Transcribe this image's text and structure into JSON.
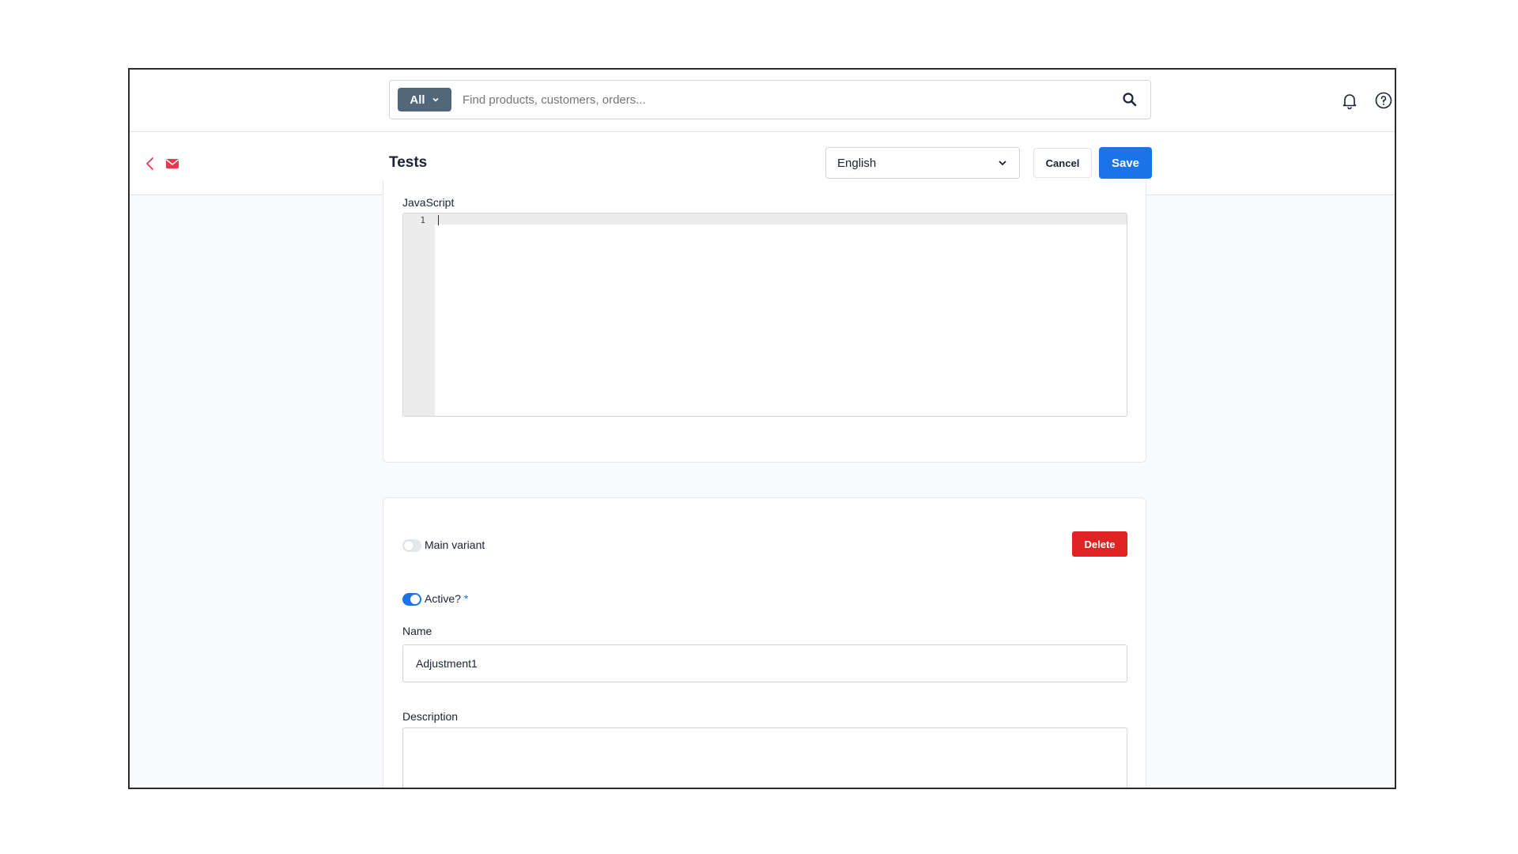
{
  "search": {
    "scope": "All",
    "placeholder": "Find products, customers, orders..."
  },
  "header": {
    "title": "Tests",
    "language": "English",
    "cancel_label": "Cancel",
    "save_label": "Save"
  },
  "javascript_section": {
    "label": "JavaScript",
    "line_number": "1",
    "code": ""
  },
  "variant": {
    "main_variant_label": "Main variant",
    "main_variant_on": false,
    "delete_label": "Delete",
    "active_label": "Active?",
    "active_required_marker": "*",
    "active_on": true,
    "name_label": "Name",
    "name_value": "Adjustment1",
    "description_label": "Description",
    "description_value": ""
  },
  "colors": {
    "primary": "#1a73e8",
    "danger": "#e02424",
    "accent_icon": "#e8394d",
    "scope_button": "#52667a"
  },
  "icons": [
    "search-icon",
    "bell-icon",
    "help-icon",
    "back-arrow-icon",
    "mail-icon",
    "chevron-down-icon"
  ]
}
